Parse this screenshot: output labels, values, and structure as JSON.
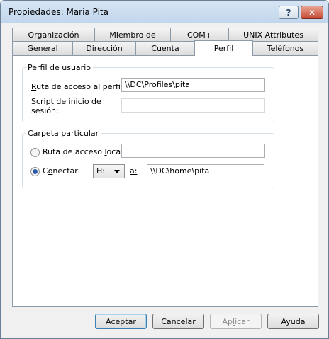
{
  "window": {
    "title": "Propiedades: Maria Pita",
    "help_label": "?",
    "close_label": "✕"
  },
  "tabs_row1": [
    {
      "label": "Organización"
    },
    {
      "label": "Miembro de"
    },
    {
      "label": "COM+"
    },
    {
      "label": "UNIX Attributes"
    }
  ],
  "tabs_row2": [
    {
      "label": "General"
    },
    {
      "label": "Dirección"
    },
    {
      "label": "Cuenta"
    },
    {
      "label": "Perfil",
      "active": true
    },
    {
      "label": "Teléfonos"
    }
  ],
  "profile_group": {
    "legend": "Perfil de usuario",
    "path_label_u": "R",
    "path_label_rest": "uta de acceso al perfil:",
    "path_value": "\\\\DC\\Profiles\\pita",
    "script_label_line1": "Script de inicio de",
    "script_label_line2": "sesión:",
    "script_value": ""
  },
  "home_group": {
    "legend": "Carpeta particular",
    "local_label_pre": "Ruta de acceso ",
    "local_label_u": "l",
    "local_label_post": "ocal:",
    "local_value": "",
    "connect_label_pre": "C",
    "connect_label_u": "o",
    "connect_label_post": "nectar:",
    "connect_checked": true,
    "drive_value": "H:",
    "to_label": "a:",
    "to_value": "\\\\DC\\home\\pita"
  },
  "buttons": {
    "ok": "Aceptar",
    "cancel": "Cancelar",
    "apply_pre": "Ap",
    "apply_u": "l",
    "apply_post": "icar",
    "help": "Ayuda"
  }
}
